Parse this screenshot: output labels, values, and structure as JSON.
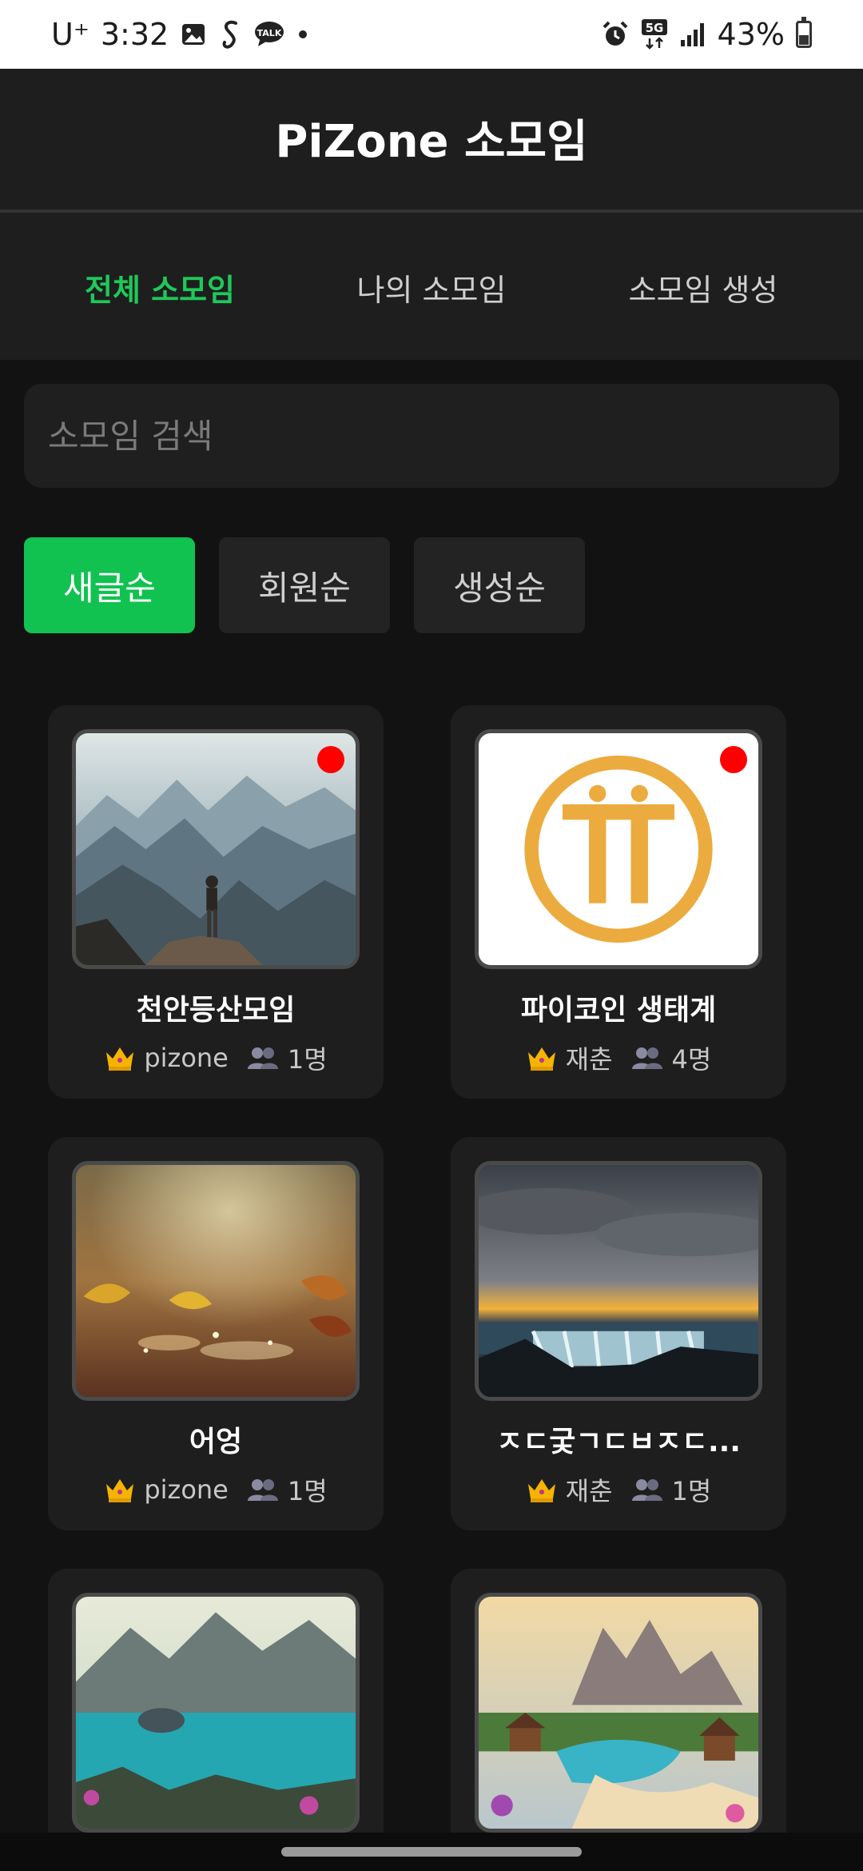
{
  "status_bar": {
    "carrier": "U⁺",
    "time": "3:32",
    "network": "5G",
    "battery_percent": "43%",
    "battery_level": 0.43,
    "icons": [
      "gallery-icon",
      "s-app-icon",
      "talk-icon",
      "dot-icon",
      "alarm-icon",
      "5g-icon",
      "signal-icon",
      "battery-icon"
    ]
  },
  "header": {
    "title": "PiZone 소모임"
  },
  "tabs": [
    {
      "label": "전체 소모임",
      "active": true
    },
    {
      "label": "나의 소모임",
      "active": false
    },
    {
      "label": "소모임 생성",
      "active": false
    }
  ],
  "search": {
    "placeholder": "소모임 검색",
    "value": ""
  },
  "sort": [
    {
      "label": "새글순",
      "active": true
    },
    {
      "label": "회원순",
      "active": false
    },
    {
      "label": "생성순",
      "active": false
    }
  ],
  "groups": [
    {
      "title": "천안등산모임",
      "owner": "pizone",
      "members": "1명",
      "has_new": true,
      "image": "mountain-hiker"
    },
    {
      "title": "파이코인 생태계",
      "owner": "재춘",
      "members": "4명",
      "has_new": true,
      "image": "pi-coin-logo"
    },
    {
      "title": "어엉",
      "owner": "pizone",
      "members": "1명",
      "has_new": false,
      "image": "autumn-leaves"
    },
    {
      "title": "ㅈㄷ궃ㄱㄷㅂㅈㄷ...",
      "owner": "재춘",
      "members": "1명",
      "has_new": false,
      "image": "ocean-waterfall"
    },
    {
      "title": "",
      "owner": "",
      "members": "",
      "has_new": false,
      "image": "alpine-lake"
    },
    {
      "title": "",
      "owner": "",
      "members": "",
      "has_new": false,
      "image": "mountain-village"
    }
  ],
  "colors": {
    "accent": "#12c251",
    "active_tab": "#1ec95a",
    "new_dot": "#ff0000",
    "background": "#121212",
    "card": "#1e1e1e"
  }
}
